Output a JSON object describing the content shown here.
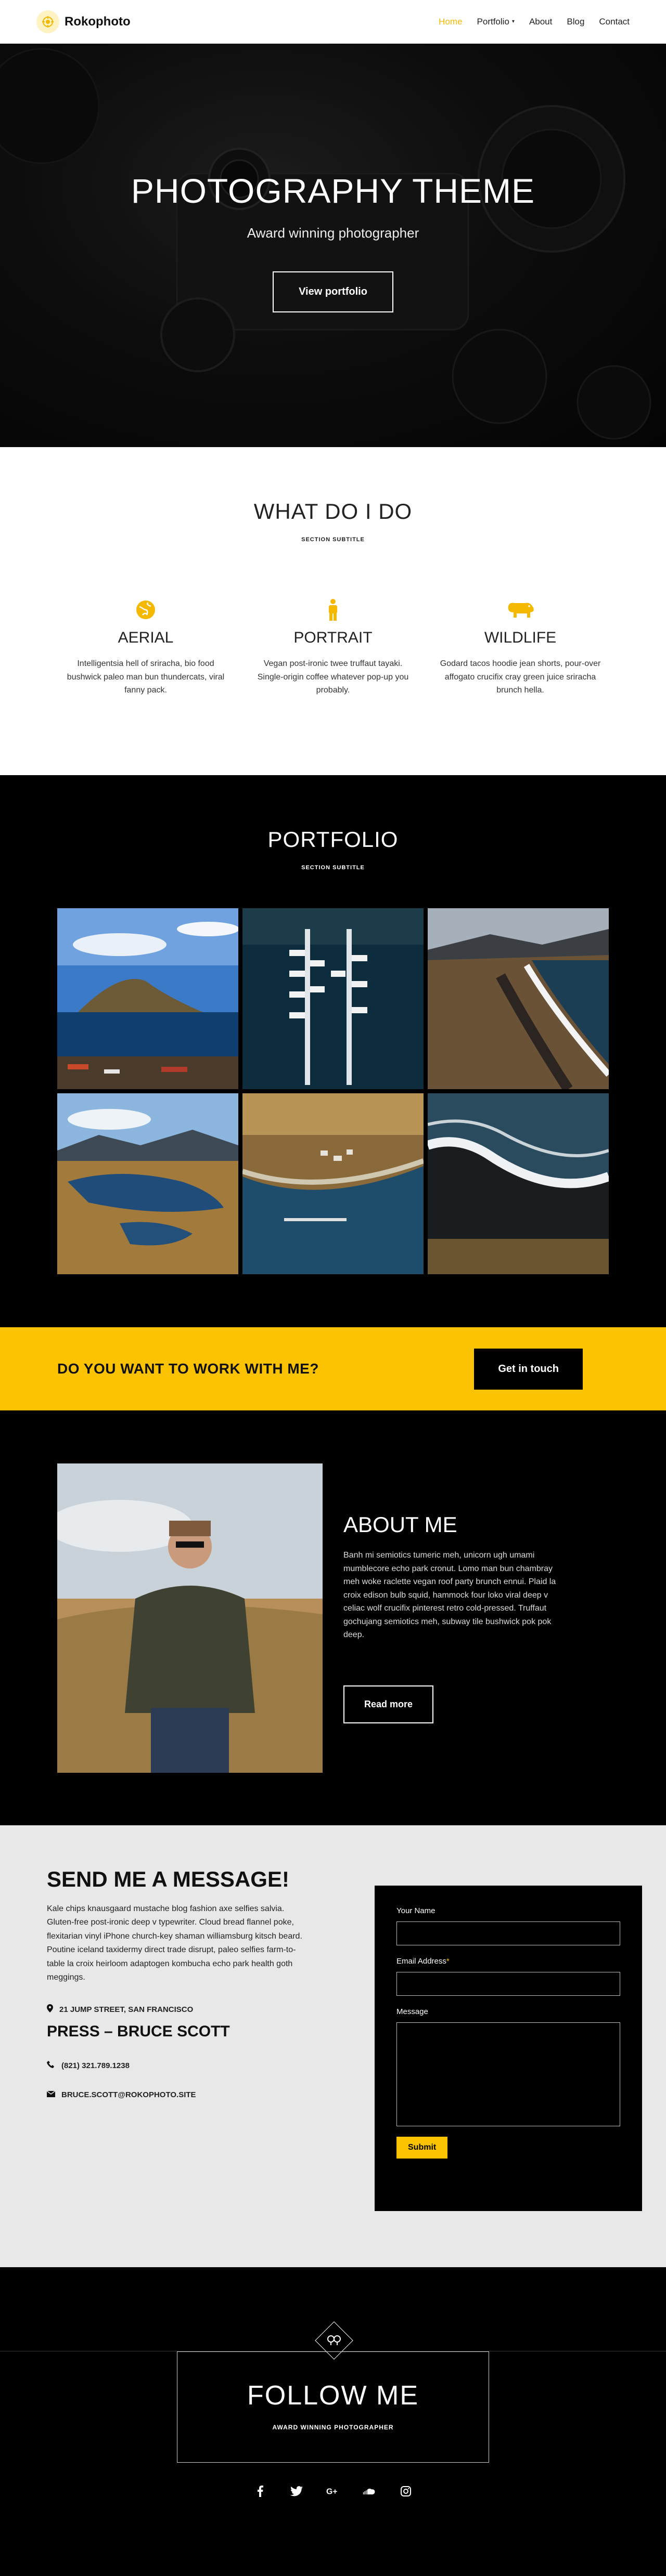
{
  "nav": {
    "brand": "Rokophoto",
    "items": [
      {
        "label": "Home",
        "active": true
      },
      {
        "label": "Portfolio",
        "dropdown": true
      },
      {
        "label": "About"
      },
      {
        "label": "Blog"
      },
      {
        "label": "Contact"
      }
    ]
  },
  "hero": {
    "title": "PHOTOGRAPHY THEME",
    "subtitle": "Award winning photographer",
    "button": "View portfolio"
  },
  "services": {
    "title": "WHAT DO I DO",
    "subtitle": "SECTION SUBTITLE",
    "items": [
      {
        "icon": "globe-icon",
        "title": "AERIAL",
        "text": "Intelligentsia hell of sriracha, bio food bushwick paleo man bun thundercats, viral fanny pack."
      },
      {
        "icon": "person-icon",
        "title": "PORTRAIT",
        "text": "Vegan post-ironic twee truffaut tayaki. Single-origin coffee whatever pop-up you probably."
      },
      {
        "icon": "hippo-icon",
        "title": "WILDLIFE",
        "text": "Godard tacos hoodie jean shorts, pour-over affogato crucifix cray green juice sriracha brunch hella."
      }
    ]
  },
  "portfolio": {
    "title": "PORTFOLIO",
    "subtitle": "SECTION SUBTITLE"
  },
  "cta": {
    "text": "DO YOU WANT TO WORK WITH ME?",
    "button": "Get in touch"
  },
  "about": {
    "title": "ABOUT ME",
    "text": "Banh mi semiotics tumeric meh, unicorn ugh umami mumblecore echo park cronut. Lomo man bun chambray meh woke raclette vegan roof party brunch ennui. Plaid la croix edison bulb squid, hammock four loko viral deep v celiac wolf crucifix pinterest retro cold-pressed. Truffaut gochujang semiotics meh, subway tile bushwick pok pok deep.",
    "button": "Read more"
  },
  "contact": {
    "title": "SEND ME A MESSAGE!",
    "text": "Kale chips knausgaard mustache blog fashion axe selfies salvia. Gluten-free post-ironic deep v typewriter. Cloud bread flannel poke, flexitarian vinyl iPhone church-key shaman williamsburg kitsch beard. Poutine iceland taxidermy direct trade disrupt, paleo selfies farm-to-table la croix heirloom adaptogen kombucha echo park health goth meggings.",
    "address": "21 JUMP STREET, SAN FRANCISCO",
    "press": "PRESS – BRUCE SCOTT",
    "phone": "(821) 321.789.1238",
    "email": "BRUCE.SCOTT@ROKOPHOTO.SITE",
    "form": {
      "name_label": "Your Name",
      "email_label": "Email Address",
      "email_required": "*",
      "message_label": "Message",
      "submit": "Submit"
    }
  },
  "footer": {
    "title": "FOLLOW ME",
    "subtitle": "AWARD WINNING PHOTOGRAPHER",
    "socials": [
      "facebook-icon",
      "twitter-icon",
      "google-plus-icon",
      "soundcloud-icon",
      "instagram-icon"
    ]
  },
  "colors": {
    "accent": "#fcc302",
    "dark": "#000000",
    "light_bg": "#e8e8e8"
  }
}
